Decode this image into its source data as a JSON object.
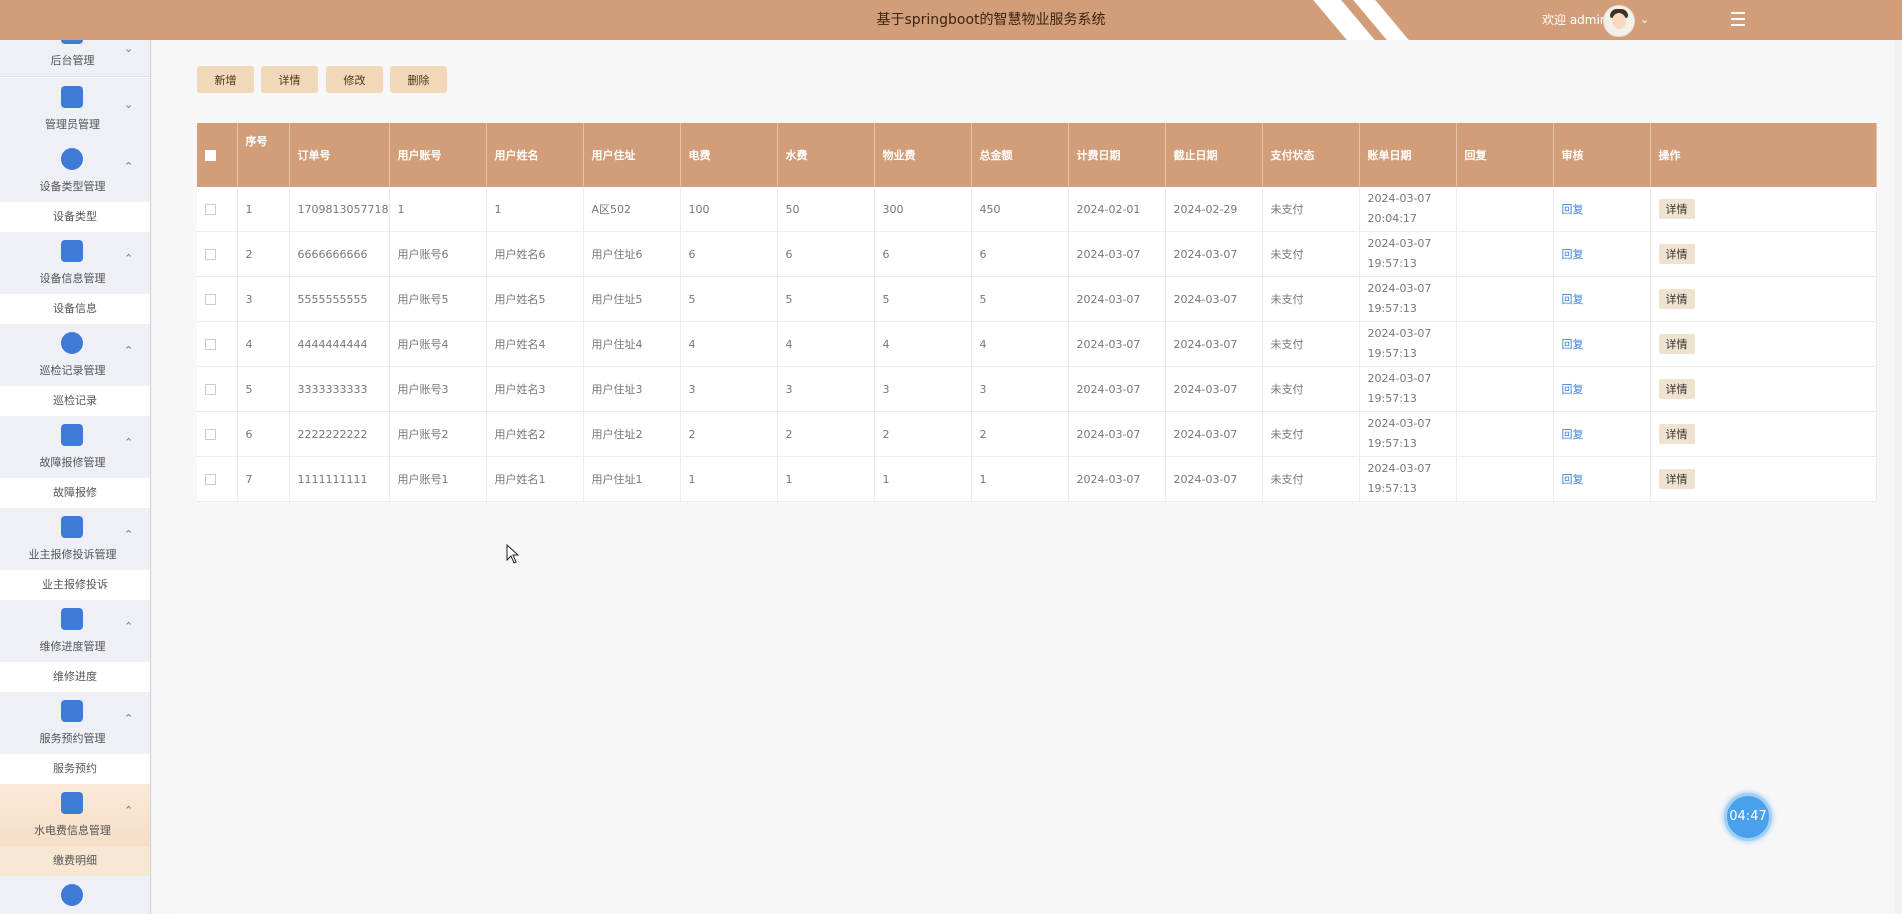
{
  "header": {
    "title": "基于springboot的智慧物业服务系统",
    "welcome": "欢迎 admin",
    "caret": "⌄"
  },
  "sidebar": {
    "groups": [
      {
        "label": "后台管理",
        "icon": "backend-icon",
        "arrow": "⌄"
      },
      {
        "label": "管理员管理",
        "icon": "grid-icon",
        "arrow": "⌄"
      },
      {
        "label": "设备类型管理",
        "icon": "circles-icon",
        "arrow": "⌃",
        "sub": "设备类型"
      },
      {
        "label": "设备信息管理",
        "icon": "briefcase-icon",
        "arrow": "⌃",
        "sub": "设备信息"
      },
      {
        "label": "巡检记录管理",
        "icon": "diamond-icon",
        "arrow": "⌃",
        "sub": "巡检记录"
      },
      {
        "label": "故障报修管理",
        "icon": "badge-icon",
        "arrow": "⌃",
        "sub": "故障报修"
      },
      {
        "label": "业主报修投诉管理",
        "icon": "window-icon",
        "arrow": "⌃",
        "sub": "业主报修投诉"
      },
      {
        "label": "维修进度管理",
        "icon": "store-icon",
        "arrow": "⌃",
        "sub": "维修进度"
      },
      {
        "label": "服务预约管理",
        "icon": "chart-icon",
        "arrow": "⌃",
        "sub": "服务预约"
      },
      {
        "label": "水电费信息管理",
        "icon": "cabinet-icon",
        "arrow": "⌃",
        "sub": "缴费明细",
        "active": true
      },
      {
        "label": "",
        "icon": "gauge-icon"
      }
    ]
  },
  "toolbar": {
    "add": "新增",
    "detail": "详情",
    "edit": "修改",
    "delete": "删除"
  },
  "table": {
    "columns": [
      "序号",
      "订单号",
      "用户账号",
      "用户姓名",
      "用户住址",
      "电费",
      "水费",
      "物业费",
      "总金额",
      "计费日期",
      "截止日期",
      "支付状态",
      "账单日期",
      "回复",
      "审核",
      "操作"
    ],
    "review_link": "回复",
    "detail_button": "详情",
    "rows": [
      {
        "no": "1",
        "order": "1709813057718",
        "account": "1",
        "name": "1",
        "address": "A区502",
        "elec": "100",
        "water": "50",
        "property": "300",
        "total": "450",
        "start": "2024-02-01",
        "end": "2024-02-29",
        "status": "未支付",
        "bill": "2024-03-07 20:04:17",
        "reply": ""
      },
      {
        "no": "2",
        "order": "6666666666",
        "account": "用户账号6",
        "name": "用户姓名6",
        "address": "用户住址6",
        "elec": "6",
        "water": "6",
        "property": "6",
        "total": "6",
        "start": "2024-03-07",
        "end": "2024-03-07",
        "status": "未支付",
        "bill": "2024-03-07 19:57:13",
        "reply": ""
      },
      {
        "no": "3",
        "order": "5555555555",
        "account": "用户账号5",
        "name": "用户姓名5",
        "address": "用户住址5",
        "elec": "5",
        "water": "5",
        "property": "5",
        "total": "5",
        "start": "2024-03-07",
        "end": "2024-03-07",
        "status": "未支付",
        "bill": "2024-03-07 19:57:13",
        "reply": ""
      },
      {
        "no": "4",
        "order": "4444444444",
        "account": "用户账号4",
        "name": "用户姓名4",
        "address": "用户住址4",
        "elec": "4",
        "water": "4",
        "property": "4",
        "total": "4",
        "start": "2024-03-07",
        "end": "2024-03-07",
        "status": "未支付",
        "bill": "2024-03-07 19:57:13",
        "reply": ""
      },
      {
        "no": "5",
        "order": "3333333333",
        "account": "用户账号3",
        "name": "用户姓名3",
        "address": "用户住址3",
        "elec": "3",
        "water": "3",
        "property": "3",
        "total": "3",
        "start": "2024-03-07",
        "end": "2024-03-07",
        "status": "未支付",
        "bill": "2024-03-07 19:57:13",
        "reply": ""
      },
      {
        "no": "6",
        "order": "2222222222",
        "account": "用户账号2",
        "name": "用户姓名2",
        "address": "用户住址2",
        "elec": "2",
        "water": "2",
        "property": "2",
        "total": "2",
        "start": "2024-03-07",
        "end": "2024-03-07",
        "status": "未支付",
        "bill": "2024-03-07 19:57:13",
        "reply": ""
      },
      {
        "no": "7",
        "order": "1111111111",
        "account": "用户账号1",
        "name": "用户姓名1",
        "address": "用户住址1",
        "elec": "1",
        "water": "1",
        "property": "1",
        "total": "1",
        "start": "2024-03-07",
        "end": "2024-03-07",
        "status": "未支付",
        "bill": "2024-03-07 19:57:13",
        "reply": ""
      }
    ]
  },
  "timer": "04:47",
  "colors": {
    "header": "#d29d79",
    "button": "#f0d8b8",
    "link": "#3e82d9",
    "icon": "#3e7bd6"
  }
}
